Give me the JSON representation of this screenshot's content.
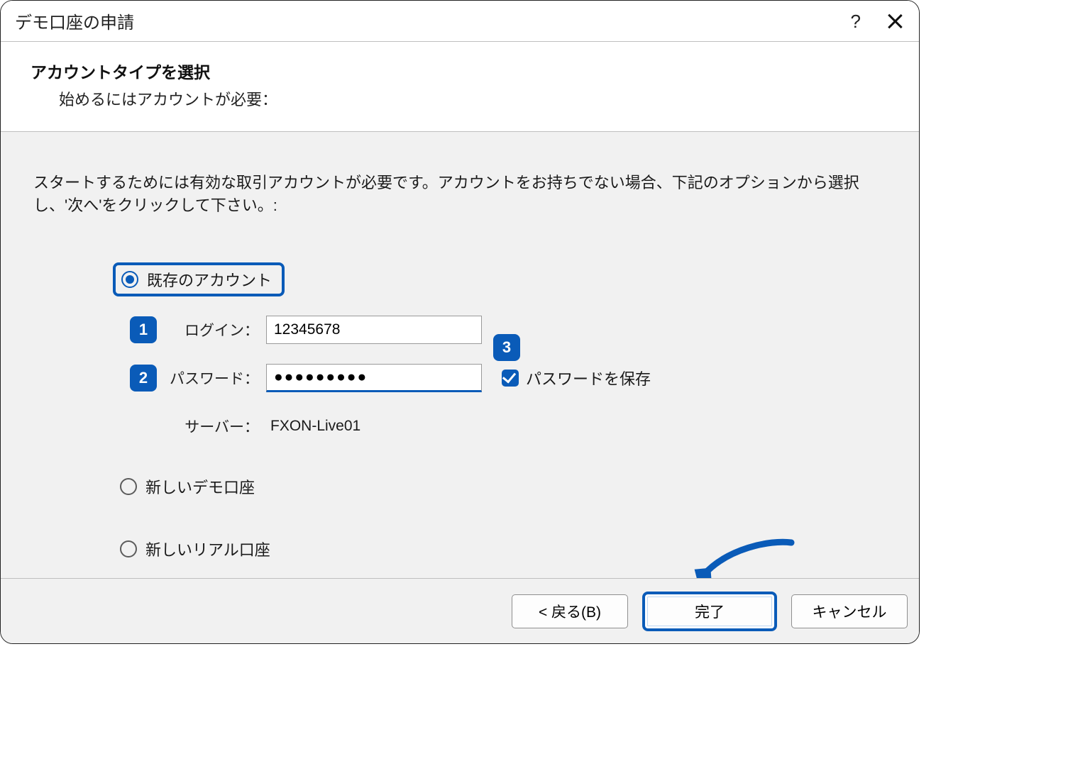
{
  "titlebar": {
    "title": "デモ口座の申請",
    "help": "?",
    "close_aria": "close"
  },
  "header": {
    "title": "アカウントタイプを選択",
    "subtitle": "始めるにはアカウントが必要："
  },
  "instructions": "スタートするためには有効な取引アカウントが必要です。アカウントをお持ちでない場合、下記のオプションから選択し、'次へ'をクリックして下さい。:",
  "options": {
    "existing_label": "既存のアカウント",
    "new_demo_label": "新しいデモ口座",
    "new_real_label": "新しいリアル口座"
  },
  "badges": {
    "one": "1",
    "two": "2",
    "three": "3"
  },
  "form": {
    "login_label": "ログイン：",
    "login_value": "12345678",
    "password_label": "パスワード：",
    "password_value": "●●●●●●●●●",
    "save_password_label": "パスワードを保存",
    "server_label": "サーバー：",
    "server_value": "FXON-Live01"
  },
  "footer": {
    "back": "< 戻る(B)",
    "finish": "完了",
    "cancel": "キャンセル"
  }
}
